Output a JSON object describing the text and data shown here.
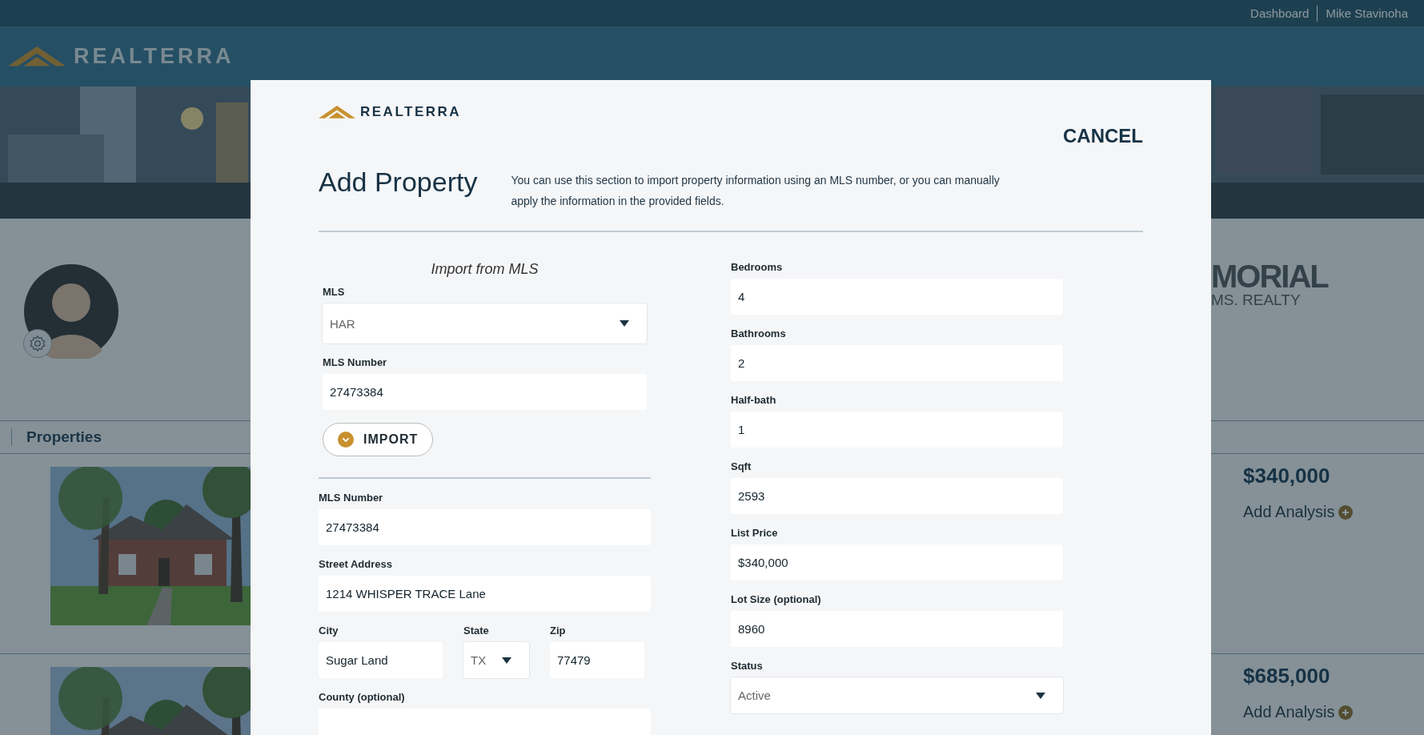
{
  "top_bar": {
    "links": [
      "Dashboard",
      "Mike Stavinoha"
    ]
  },
  "header": {
    "logo_text": "REALTERRA"
  },
  "brokerage_logo": {
    "name": "MORIAL",
    "subtitle": "MS. REALTY"
  },
  "properties_header": "Properties",
  "properties": [
    {
      "kind": "picture",
      "price": "$340,000",
      "action": "Add Analysis"
    },
    {
      "kind": "picture",
      "price": "$685,000",
      "action": "Add Analysis"
    }
  ],
  "modal": {
    "logo_text": "REALTERRA",
    "cancel": "CANCEL",
    "title": "Add Property",
    "description": "You can use this section to import property information using an MLS number, or you can manually apply the information in the provided fields.",
    "import": {
      "heading": "Import from MLS",
      "fields": [
        {
          "kind": "select",
          "label": "MLS",
          "value": "HAR"
        },
        {
          "kind": "text",
          "label": "MLS Number",
          "value": "27473384"
        }
      ],
      "button": "IMPORT"
    },
    "left_rows": [
      [
        {
          "kind": "text",
          "label": "MLS Number",
          "value": "27473384"
        }
      ],
      [
        {
          "kind": "text",
          "label": "Street Address",
          "value": "1214 WHISPER TRACE Lane"
        }
      ],
      [
        {
          "kind": "text",
          "label": "City",
          "value": "Sugar Land"
        },
        {
          "kind": "select",
          "label": "State",
          "value": "TX"
        },
        {
          "kind": "text",
          "label": "Zip",
          "value": "77479"
        }
      ],
      [
        {
          "kind": "text",
          "label": "County (optional)"
        }
      ]
    ],
    "right_fields": [
      {
        "kind": "text",
        "label": "Bedrooms",
        "value": "4"
      },
      {
        "kind": "text",
        "label": "Bathrooms",
        "value": "2"
      },
      {
        "kind": "text",
        "label": "Half-bath",
        "value": "1"
      },
      {
        "kind": "text",
        "label": "Sqft",
        "value": "2593"
      },
      {
        "kind": "text",
        "label": "List Price",
        "value": "$340,000"
      },
      {
        "kind": "text",
        "label": "Lot Size (optional)",
        "value": "8960"
      },
      {
        "kind": "select",
        "label": "Status",
        "value": "Active"
      }
    ]
  }
}
